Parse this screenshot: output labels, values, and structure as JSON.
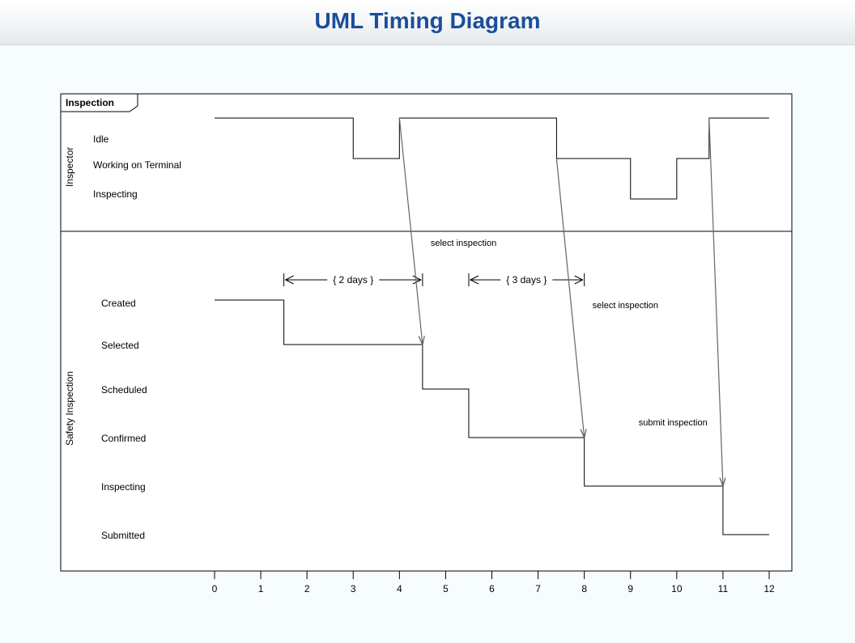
{
  "title": "UML Timing Diagram",
  "frame_label": "Inspection",
  "time_axis": {
    "start": 0,
    "end": 12,
    "ticks": [
      0,
      1,
      2,
      3,
      4,
      5,
      6,
      7,
      8,
      9,
      10,
      11,
      12
    ]
  },
  "lifelines": {
    "inspector": {
      "name": "Inspector",
      "states": [
        "Idle",
        "Working on Terminal",
        "Inspecting"
      ],
      "waveform": [
        {
          "t": 0,
          "state": "Idle"
        },
        {
          "t": 3,
          "state": "Working on Terminal"
        },
        {
          "t": 4,
          "state": "Idle"
        },
        {
          "t": 7.4,
          "state": "Working on Terminal"
        },
        {
          "t": 9,
          "state": "Inspecting"
        },
        {
          "t": 10,
          "state": "Working on Terminal"
        },
        {
          "t": 10.7,
          "state": "Idle"
        },
        {
          "t": 12,
          "state": "Idle"
        }
      ]
    },
    "safety": {
      "name": "Safety Inspection",
      "states": [
        "Created",
        "Selected",
        "Scheduled",
        "Confirmed",
        "Inspecting",
        "Submitted"
      ],
      "waveform": [
        {
          "t": 0,
          "state": "Created"
        },
        {
          "t": 1.5,
          "state": "Selected"
        },
        {
          "t": 4.5,
          "state": "Scheduled"
        },
        {
          "t": 5.5,
          "state": "Confirmed"
        },
        {
          "t": 8,
          "state": "Inspecting"
        },
        {
          "t": 11,
          "state": "Submitted"
        },
        {
          "t": 12,
          "state": "Submitted"
        }
      ]
    }
  },
  "messages": [
    {
      "label": "select inspection",
      "from_t": 4,
      "to_t": 4.5,
      "from_lifeline": "inspector",
      "from_state": "Idle",
      "to_lifeline": "safety",
      "to_state": "Selected",
      "label_x": 5.1,
      "label_y_region": "upper",
      "label_pos": "top"
    },
    {
      "label": "select inspection",
      "from_t": 7.4,
      "to_t": 8,
      "from_lifeline": "inspector",
      "from_state": "Working on Terminal",
      "to_lifeline": "safety",
      "to_state": "Confirmed",
      "label_x": 8.7,
      "label_y_region": "lower",
      "label_pos": "right-upper"
    },
    {
      "label": "submit inspection",
      "from_t": 10.7,
      "to_t": 11,
      "from_lifeline": "inspector",
      "from_state": "Idle",
      "to_lifeline": "safety",
      "to_state": "Inspecting",
      "label_x": 10.0,
      "label_y_region": "lower",
      "label_pos": "right-lower"
    }
  ],
  "constraints": [
    {
      "label": "{ 2 days }",
      "t0": 1.5,
      "t1": 4.5
    },
    {
      "label": "{ 3 days }",
      "t0": 5.5,
      "t1": 8
    }
  ]
}
